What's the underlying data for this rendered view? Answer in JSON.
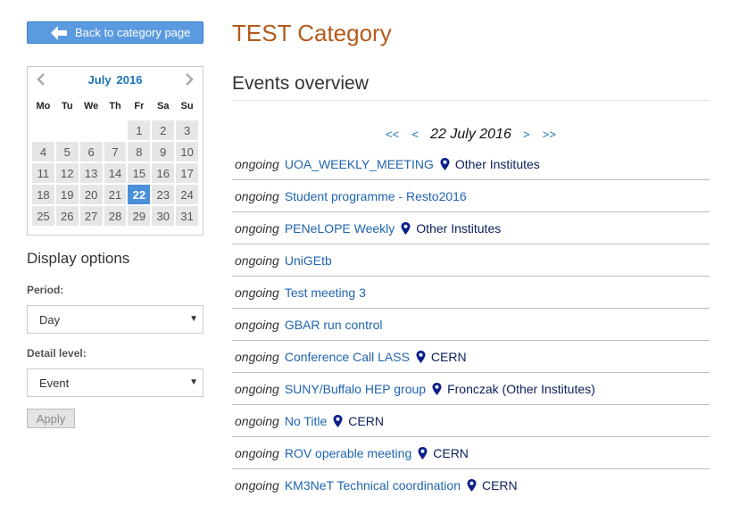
{
  "sidebar": {
    "back_label": "Back to category page",
    "calendar": {
      "month": "July",
      "year": "2016",
      "weekdays": [
        "Mo",
        "Tu",
        "We",
        "Th",
        "Fr",
        "Sa",
        "Su"
      ],
      "weeks": [
        [
          "",
          "",
          "",
          "",
          "1",
          "2",
          "3"
        ],
        [
          "4",
          "5",
          "6",
          "7",
          "8",
          "9",
          "10"
        ],
        [
          "11",
          "12",
          "13",
          "14",
          "15",
          "16",
          "17"
        ],
        [
          "18",
          "19",
          "20",
          "21",
          "22",
          "23",
          "24"
        ],
        [
          "25",
          "26",
          "27",
          "28",
          "29",
          "30",
          "31"
        ]
      ],
      "selected": "22"
    },
    "display_options_title": "Display options",
    "period_label": "Period:",
    "period_value": "Day",
    "detail_label": "Detail level:",
    "detail_value": "Event",
    "apply_label": "Apply"
  },
  "main": {
    "category_title": "TEST Category",
    "overview_title": "Events overview",
    "date_nav": {
      "first": "<<",
      "prev": "<",
      "current": "22 July 2016",
      "next": ">",
      "last": ">>"
    },
    "events": [
      {
        "status": "ongoing",
        "title": "UOA_WEEKLY_MEETING",
        "location": "Other Institutes"
      },
      {
        "status": "ongoing",
        "title": "Student programme - Resto2016",
        "location": ""
      },
      {
        "status": "ongoing",
        "title": "PENeLOPE Weekly",
        "location": "Other Institutes"
      },
      {
        "status": "ongoing",
        "title": "UniGEtb",
        "location": ""
      },
      {
        "status": "ongoing",
        "title": "Test meeting 3",
        "location": ""
      },
      {
        "status": "ongoing",
        "title": "GBAR run control",
        "location": ""
      },
      {
        "status": "ongoing",
        "title": "Conference Call LASS",
        "location": "CERN"
      },
      {
        "status": "ongoing",
        "title": "SUNY/Buffalo HEP group",
        "location": "Fronczak (Other Institutes)"
      },
      {
        "status": "ongoing",
        "title": "No Title",
        "location": "CERN"
      },
      {
        "status": "ongoing",
        "title": "ROV operable meeting",
        "location": "CERN"
      },
      {
        "status": "ongoing",
        "title": "KM3NeT Technical coordination",
        "location": "CERN"
      }
    ]
  },
  "colors": {
    "accent": "#1f64b0",
    "category_title": "#b35a1b",
    "button": "#5b9ae0",
    "selected_day": "#4a90d9"
  },
  "icons": {
    "back": "left-arrow-icon",
    "location": "map-pin-icon",
    "prev_month": "chevron-left-icon",
    "next_month": "chevron-right-icon",
    "select": "caret-down-icon"
  }
}
